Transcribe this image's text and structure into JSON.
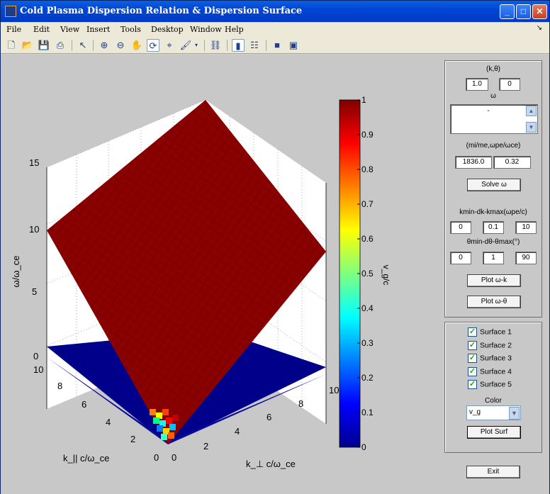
{
  "window": {
    "title": "Cold Plasma Dispersion Relation & Dispersion Surface"
  },
  "menu": [
    "File",
    "Edit",
    "View",
    "Insert",
    "Tools",
    "Desktop",
    "Window",
    "Help"
  ],
  "toolbar_icons": [
    "new-file-icon",
    "open-folder-icon",
    "save-icon",
    "print-icon",
    "pointer-icon",
    "zoom-in-icon",
    "zoom-out-icon",
    "pan-hand-icon",
    "rotate-3d-icon",
    "data-cursor-icon",
    "brush-icon",
    "link-icon",
    "colorbar-icon",
    "legend-icon",
    "hide-plot-tools-icon",
    "show-plot-tools-icon"
  ],
  "chart_data": {
    "type": "surface",
    "zlabel": "ω/ω_ce",
    "xlabel": "k_|| c/ω_ce",
    "ylabel": "k_⊥ c/ω_ce",
    "colorbar_label": "v_g/c",
    "z_ticks": [
      0,
      5,
      10,
      15
    ],
    "z_range": [
      0,
      15
    ],
    "kpar_ticks": [
      0,
      2,
      4,
      6,
      8,
      10
    ],
    "kperp_ticks": [
      0,
      2,
      4,
      6,
      8,
      10
    ],
    "kpar_range": [
      0,
      10
    ],
    "kperp_range": [
      0,
      10
    ],
    "colorbar_ticks": [
      0,
      0.1,
      0.2,
      0.3,
      0.4,
      0.5,
      0.6,
      0.7,
      0.8,
      0.9,
      1
    ],
    "colorbar_range": [
      0,
      1
    ],
    "colormap": "jet",
    "surfaces": [
      {
        "name": "upper branch",
        "color": "#7f0000",
        "z_at_origin": 0,
        "z_at_kpar10_kperp0": 10,
        "z_at_kpar0_kperp10": 10,
        "z_at_kpar10_kperp10": 14.1
      },
      {
        "name": "lower branch",
        "color": "#00008f",
        "z_at_origin": 0,
        "z_at_kpar10_kperp0": 1.0,
        "z_at_kpar0_kperp10": 0.15,
        "z_at_kpar10_kperp10": 1.0
      }
    ]
  },
  "controls": {
    "k_theta_label": "(k,θ)",
    "k_value": "1.0",
    "theta_value": "0",
    "omega_label": "ω",
    "omega_list_value": "-",
    "params_label": "(mi/me,ωpe/ωce)",
    "mi_me_value": "1836.0",
    "wpe_wce_value": "0.32",
    "solve_button": "Solve ω",
    "k_range_label": "kmin-dk-kmax(ωpe/c)",
    "kmin": "0",
    "dk": "0.1",
    "kmax": "10",
    "theta_range_label": "θmin-dθ-θmax(°)",
    "theta_min": "0",
    "dtheta": "1",
    "theta_max": "90",
    "plot_wk_button": "Plot ω-k",
    "plot_wtheta_button": "Plot ω-θ",
    "surfaces": [
      {
        "label": "Surface 1",
        "checked": true
      },
      {
        "label": "Surface 2",
        "checked": true
      },
      {
        "label": "Surface 3",
        "checked": true
      },
      {
        "label": "Surface 4",
        "checked": true
      },
      {
        "label": "Surface 5",
        "checked": true
      }
    ],
    "color_label": "Color",
    "color_select_value": "v_g",
    "plot_surf_button": "Plot Surf",
    "exit_button": "Exit"
  }
}
